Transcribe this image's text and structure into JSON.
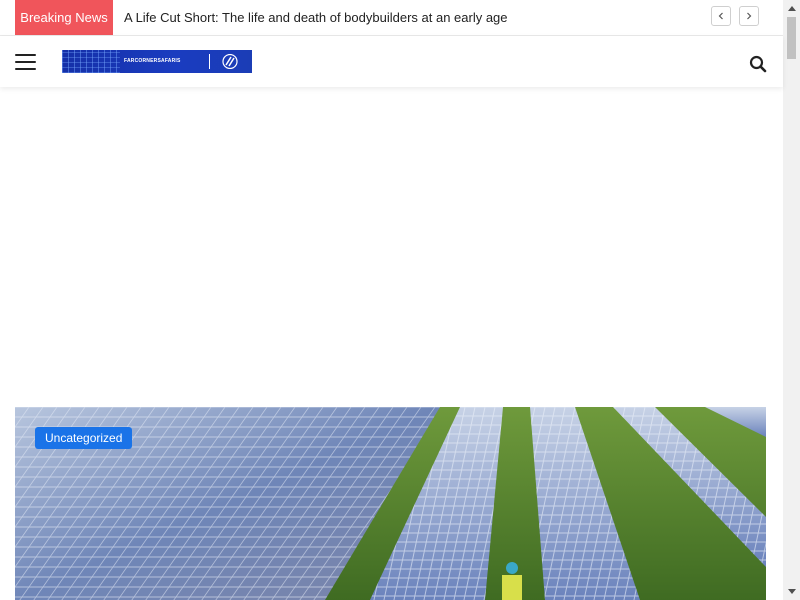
{
  "breaking": {
    "label": "Breaking News",
    "headline": "A Life Cut Short: The life and death of bodybuilders at an early age",
    "prev_icon": "chevron-left-icon",
    "next_icon": "chevron-right-icon"
  },
  "header": {
    "menu_icon": "hamburger-menu-icon",
    "logo_text": "FARCORNERSAFARIS",
    "search_icon": "search-icon"
  },
  "featured": {
    "category": "Uncategorized",
    "image_subject": "solar-panel-field-photo"
  },
  "colors": {
    "breaking_bg": "#f0555b",
    "badge_bg": "#1a73e8",
    "logo_bg": "#1a3cc0"
  }
}
